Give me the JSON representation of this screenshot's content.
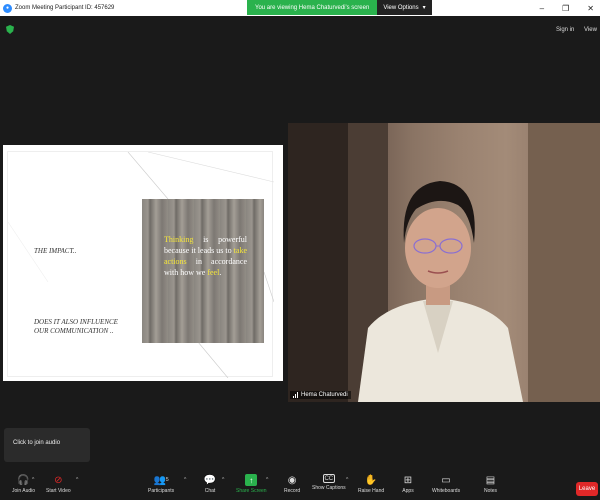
{
  "window": {
    "title": "Zoom Meeting Participant ID: 457629",
    "minimize_icon": "minimize-icon",
    "maximize_icon": "maximize-icon",
    "close_icon": "close-icon"
  },
  "banner": {
    "viewing_text": "You are viewing Hema Chaturvedi's screen",
    "view_options_label": "View Options"
  },
  "topbar": {
    "sign_in": "Sign in",
    "view": "View"
  },
  "slide": {
    "impact": "THE IMPACT..",
    "influence_line1": "DOES IT ALSO INFLUENCE",
    "influence_line2": "OUR COMMUNICATION ..",
    "quote": {
      "w1": "Thinking",
      "t1": " is powerful because it leads us to ",
      "w2": "take actions",
      "t2": " in accordance with how we ",
      "w3": "feel",
      "t3": "."
    }
  },
  "video": {
    "participant_name": "Hema Chaturvedi"
  },
  "tooltip": {
    "text": "Click to join audio"
  },
  "toolbar": {
    "join_audio": "Join Audio",
    "start_video": "Start Video",
    "participants": "Participants",
    "participants_count": "5",
    "chat": "Chat",
    "share_screen": "Share Screen",
    "record": "Record",
    "show_captions": "Show Captions",
    "raise_hand": "Raise Hand",
    "apps": "Apps",
    "whiteboards": "Whiteboards",
    "notes": "Notes",
    "leave": "Leave"
  },
  "colors": {
    "accent_green": "#2ab24d",
    "leave_red": "#e02828",
    "highlight_yellow": "#f5e63a",
    "zoom_blue": "#2d8cff"
  }
}
